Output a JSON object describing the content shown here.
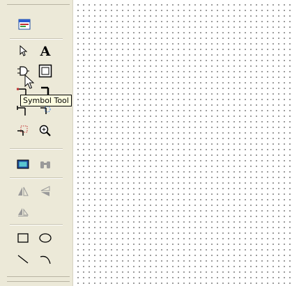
{
  "tooltip": {
    "text": "Symbol Tool"
  },
  "toolbar": {
    "tools": [
      {
        "name": "properties-tool",
        "icon": "window-properties-icon"
      },
      {
        "name": "select-tool",
        "icon": "arrow-pointer-icon"
      },
      {
        "name": "text-tool",
        "icon": "letter-a-icon"
      },
      {
        "name": "symbol-tool",
        "icon": "symbol-icon",
        "state": "hovered"
      },
      {
        "name": "frame-tool",
        "icon": "frame-icon"
      },
      {
        "name": "wire-tool",
        "icon": "wire-icon"
      },
      {
        "name": "bus-tool",
        "icon": "bus-icon"
      },
      {
        "name": "net-tool",
        "icon": "net-icon"
      },
      {
        "name": "junction-tool",
        "icon": "junction-icon"
      },
      {
        "name": "port-tool",
        "icon": "port-icon"
      },
      {
        "name": "zoom-tool",
        "icon": "zoom-in-icon"
      },
      {
        "name": "display-tool",
        "icon": "monitor-icon"
      },
      {
        "name": "find-tool",
        "icon": "binoculars-icon",
        "state": "disabled"
      },
      {
        "name": "flip-horizontal-tool",
        "icon": "flip-horizontal-icon",
        "state": "disabled"
      },
      {
        "name": "flip-vertical-tool",
        "icon": "flip-vertical-icon",
        "state": "disabled"
      },
      {
        "name": "rotate-tool",
        "icon": "rotate-icon",
        "state": "disabled"
      },
      {
        "name": "rectangle-tool",
        "icon": "rectangle-icon"
      },
      {
        "name": "ellipse-tool",
        "icon": "ellipse-icon"
      },
      {
        "name": "line-tool",
        "icon": "line-icon"
      },
      {
        "name": "arc-tool",
        "icon": "arc-icon"
      }
    ]
  },
  "colors": {
    "toolbar_bg": "#ece9d8",
    "tooltip_bg": "#ffffe1",
    "grid_dot": "#7a7a7a"
  }
}
